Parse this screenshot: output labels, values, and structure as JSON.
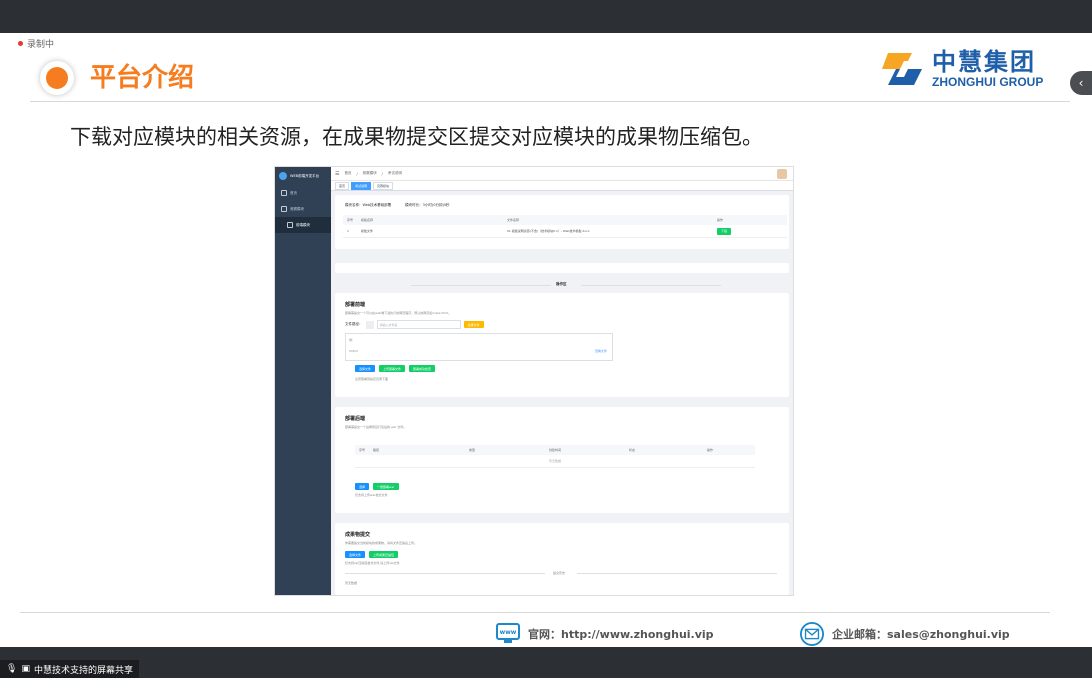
{
  "recording_label": "录制中",
  "slide": {
    "title": "平台介绍",
    "body": "下载对应模块的相关资源，在成果物提交区提交对应模块的成果物压缩包。"
  },
  "logo": {
    "cn": "中慧集团",
    "en": "ZHONGHUI GROUP"
  },
  "footer": {
    "website": "官网：http://www.zhonghui.vip",
    "email": "企业邮箱：sales@zhonghui.vip"
  },
  "share_label": "中慧技术支持的屏幕共享",
  "colors": {
    "accent": "#f57c1f",
    "brand_blue": "#1f5ea8",
    "sidebar": "#304156"
  },
  "app": {
    "sidebar_title": "WEB前端开发平台",
    "sidebar_items": [
      "首页",
      "竞赛模块",
      "前端模块"
    ],
    "breadcrumb": [
      "首页",
      "竞赛模块",
      "考试说明"
    ],
    "tags": [
      "首页",
      "考试说明",
      "竞赛模块"
    ],
    "info": {
      "module": "模块名称：Web技术基础部署",
      "time": "模块时长：3小时(0分钟)5秒"
    },
    "table1": {
      "headers": [
        "序号",
        "模板名称",
        "文件名称",
        "操作"
      ],
      "rows": [
        [
          "1",
          "模板文件",
          "01 模板说明资源(不含)（技术模块0.1）- Web技术模板.docx",
          "下载"
        ]
      ]
    },
    "op_zone": "操作区",
    "section1": {
      "title": "部署前端",
      "desc": "部署需提交一个可以在web端下载执行的网页程序，预认的网页如index.html。",
      "file_label": "文件路径：",
      "file_placeholder": "请输入文件名",
      "choose_btn": "选择文件",
      "box_hint": "例：",
      "box_file": "Chtml",
      "box_link": "查看文件",
      "buttons": [
        "选择文件",
        "上传部署文件",
        "部署成功检查"
      ],
      "note": "注意部署到指定目录下面"
    },
    "section2": {
      "title": "部署后端",
      "desc": "部署需提交一个后端项目打包后的 war 文件。",
      "headers": [
        "序号",
        "路径",
        "类型",
        "创建时间",
        "状态",
        "操作"
      ],
      "empty": "暂无数据",
      "buttons": [
        "选择",
        "一键部署war"
      ],
      "note": "仅支持上传war格式文件"
    },
    "section3": {
      "title": "成果物提交",
      "desc": "你需要提交当前模块的成果物，请将文件压缩后上传。",
      "buttons": [
        "选择文件",
        "上传成果压缩包"
      ],
      "note": "仅支持zip压缩包格式文件,请上传zip文件",
      "history": "提交历史",
      "empty": "暂无数据"
    }
  }
}
